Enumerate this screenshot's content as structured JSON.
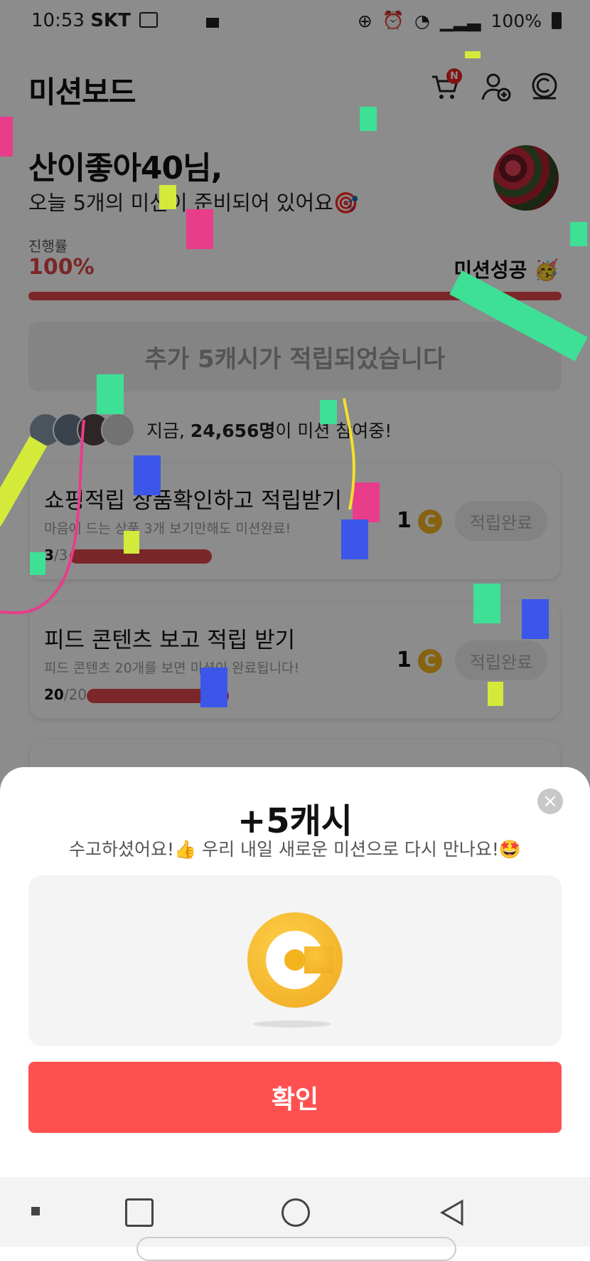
{
  "status_bar": {
    "time": "10:53",
    "carrier": "SKT",
    "battery": "100%"
  },
  "header": {
    "title": "미션보드",
    "cart_badge": "N"
  },
  "greeting": {
    "name": "산이좋아40님,",
    "subtitle": "오늘 5개의 미션이 준비되어 있어요🎯"
  },
  "progress": {
    "label": "진행률",
    "value": "100%",
    "status": "미션성공 🥳",
    "fraction": 1.0
  },
  "earn_banner": "추가 5캐시가 적립되었습니다",
  "participants": {
    "prefix": "지금, ",
    "count": "24,656명",
    "suffix": "이 미션 참여중!"
  },
  "missions": [
    {
      "title": "쇼핑적립 상품확인하고 적립받기",
      "desc": "마음에 드는 상품 3개 보기만해도 미션완료!",
      "done": "3",
      "total": "/3",
      "reward": "1",
      "button": "적립완료",
      "fraction": 1.0
    },
    {
      "title": "피드 콘텐츠 보고 적립 받기",
      "desc": "피드 콘텐츠 20개를 보면 미션이 완료됩니다!",
      "done": "20",
      "total": "/20",
      "reward": "1",
      "button": "적립완료",
      "fraction": 1.0
    }
  ],
  "modal": {
    "title": "+5캐시",
    "subtitle": "수고하셨어요!👍 우리 내일 새로운 미션으로 다시 만나요!🤩",
    "confirm": "확인"
  },
  "colors": {
    "accent": "#e0454a",
    "confirm": "#ff5050",
    "coin": "#f2b51e"
  }
}
